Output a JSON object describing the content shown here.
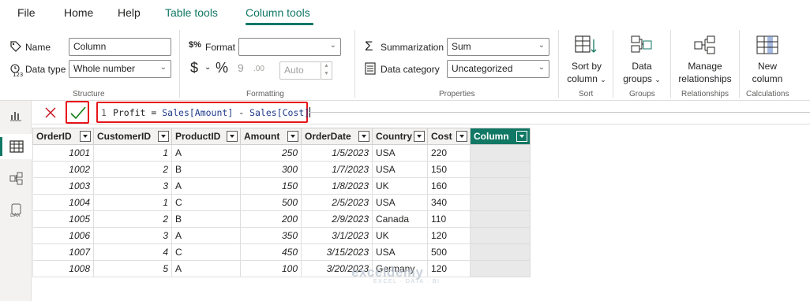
{
  "menu": {
    "tabs": [
      {
        "label": "File"
      },
      {
        "label": "Home"
      },
      {
        "label": "Help"
      },
      {
        "label": "Table tools"
      },
      {
        "label": "Column tools"
      }
    ],
    "active_tab": "Column tools",
    "accent_color": "#117865"
  },
  "ribbon": {
    "structure": {
      "name_label": "Name",
      "name_value": "Column",
      "datatype_label": "Data type",
      "datatype_value": "Whole number",
      "group_title": "Structure"
    },
    "formatting": {
      "format_label": "Format",
      "format_value": "",
      "currency_symbol": "$",
      "percent_symbol": "%",
      "comma_symbol": "9",
      "decimal_value": "Auto",
      "group_title": "Formatting"
    },
    "properties": {
      "summarization_label": "Summarization",
      "summarization_value": "Sum",
      "category_label": "Data category",
      "category_value": "Uncategorized",
      "group_title": "Properties"
    },
    "sort": {
      "button_line1": "Sort by",
      "button_line2": "column",
      "group_title": "Sort"
    },
    "groups": {
      "button_line1": "Data",
      "button_line2": "groups",
      "group_title": "Groups"
    },
    "relationships": {
      "button_line1": "Manage",
      "button_line2": "relationships",
      "group_title": "Relationships"
    },
    "calculations": {
      "button_line1": "New",
      "button_line2": "column",
      "group_title": "Calculations"
    }
  },
  "formula": {
    "line_number": "1",
    "name_part": "Profit = ",
    "ref1": "Sales[Amount]",
    "op": " - ",
    "ref2": "Sales[Cost]"
  },
  "table": {
    "columns": [
      "OrderID",
      "CustomerID",
      "ProductID",
      "Amount",
      "OrderDate",
      "Country",
      "Cost",
      "Column"
    ],
    "rows": [
      [
        "1001",
        "1",
        "A",
        "250",
        "1/5/2023",
        "USA",
        "220"
      ],
      [
        "1002",
        "2",
        "B",
        "300",
        "1/7/2023",
        "USA",
        "150"
      ],
      [
        "1003",
        "3",
        "A",
        "150",
        "1/8/2023",
        "UK",
        "160"
      ],
      [
        "1004",
        "1",
        "C",
        "500",
        "2/5/2023",
        "USA",
        "340"
      ],
      [
        "1005",
        "2",
        "B",
        "200",
        "2/9/2023",
        "Canada",
        "110"
      ],
      [
        "1006",
        "3",
        "A",
        "350",
        "3/1/2023",
        "UK",
        "120"
      ],
      [
        "1007",
        "4",
        "C",
        "450",
        "3/15/2023",
        "USA",
        "500"
      ],
      [
        "1008",
        "5",
        "A",
        "100",
        "3/20/2023",
        "Germany",
        "120"
      ]
    ]
  },
  "watermark": {
    "name": "exceldemy",
    "tagline": "EXCEL · DATA · BI"
  }
}
